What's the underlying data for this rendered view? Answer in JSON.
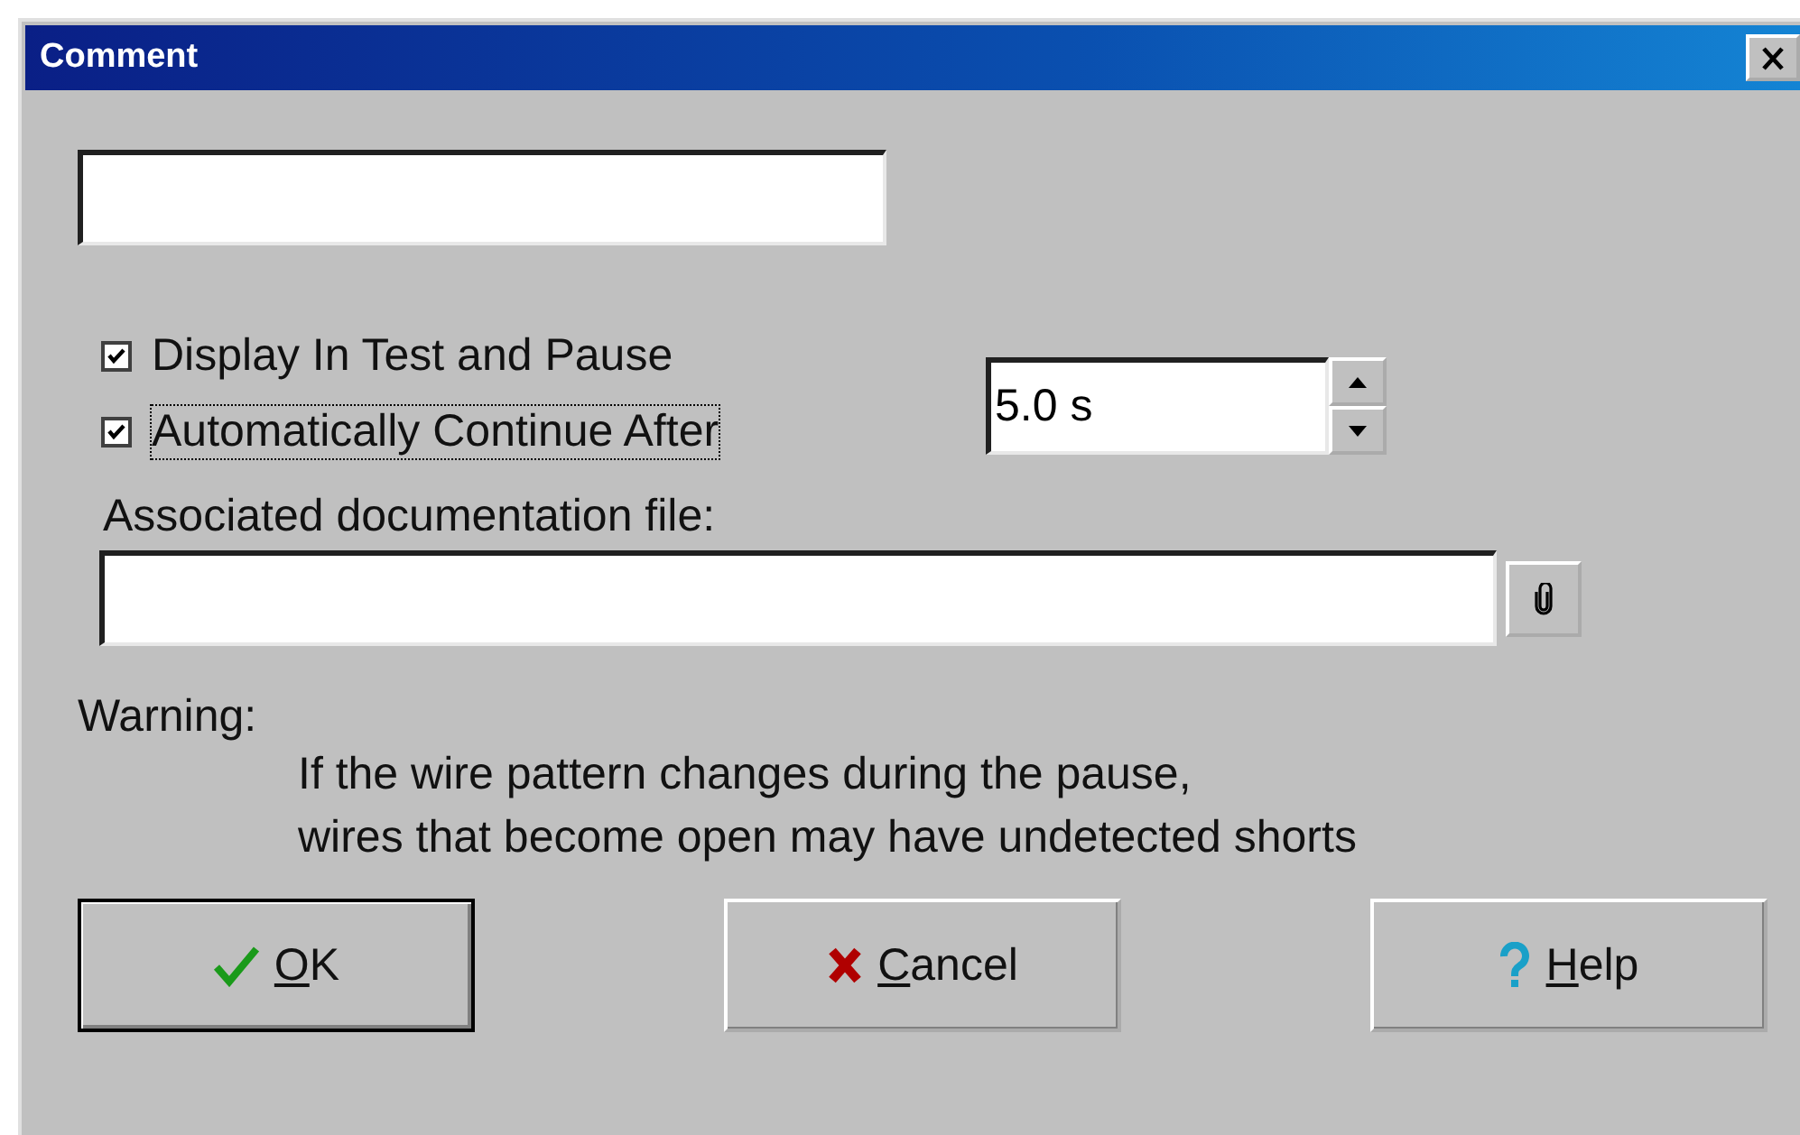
{
  "window": {
    "title": "Comment"
  },
  "options": [
    {
      "label": "Display In Test and Pause",
      "checked": true,
      "focused": false
    },
    {
      "label": "Automatically Continue After",
      "checked": true,
      "focused": true
    }
  ],
  "delay": {
    "value": "5.0 s"
  },
  "documentation": {
    "label": "Associated documentation file:"
  },
  "warning": {
    "title": "Warning:",
    "lines": [
      "If the wire pattern changes during the pause,",
      "wires that become open may have undetected shorts"
    ]
  },
  "buttons": [
    {
      "kind": "ok",
      "label": "OK"
    },
    {
      "kind": "cancel",
      "label": "Cancel"
    },
    {
      "kind": "help",
      "label": "Help"
    }
  ]
}
